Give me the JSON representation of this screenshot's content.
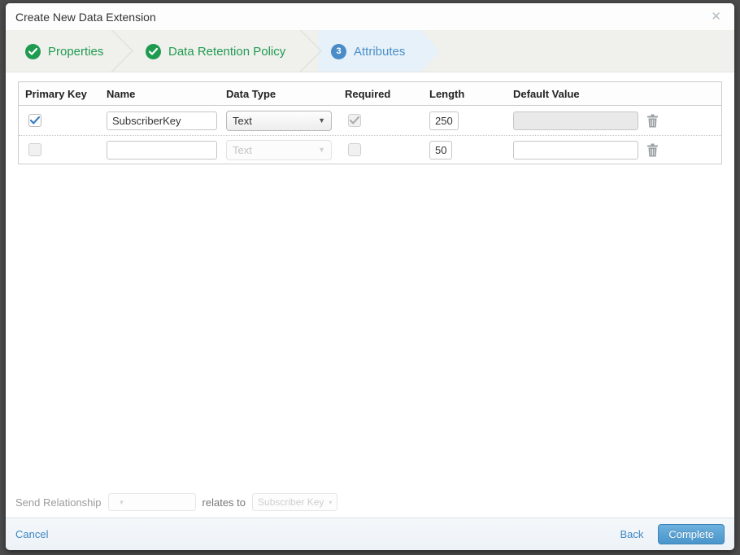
{
  "modal": {
    "title": "Create New Data Extension",
    "close_glyph": "✕"
  },
  "steps": {
    "properties": {
      "label": "Properties",
      "state": "complete"
    },
    "retention": {
      "label": "Data Retention Policy",
      "state": "complete"
    },
    "attributes": {
      "label": "Attributes",
      "number": "3",
      "state": "active"
    }
  },
  "table": {
    "headers": {
      "primary_key": "Primary Key",
      "name": "Name",
      "data_type": "Data Type",
      "required": "Required",
      "length": "Length",
      "default_value": "Default Value"
    },
    "rows": [
      {
        "primary_key_checked": true,
        "name": "SubscriberKey",
        "data_type": "Text",
        "required_checked": true,
        "length": "250",
        "default_value": ""
      },
      {
        "primary_key_checked": false,
        "name": "",
        "data_type": "Text",
        "required_checked": false,
        "length": "50",
        "default_value": ""
      }
    ]
  },
  "send_relationship": {
    "label": "Send Relationship",
    "relates_to": "relates to",
    "field_value": "Subscriber Key",
    "field_caret": "▾"
  },
  "footer": {
    "cancel": "Cancel",
    "back": "Back",
    "complete": "Complete"
  },
  "colors": {
    "accent_green": "#1f9b51",
    "accent_blue": "#4a90c9",
    "step_active_bg": "#e7f1f9",
    "link_blue": "#3d87c3",
    "overlay": "#4c4c4c"
  }
}
